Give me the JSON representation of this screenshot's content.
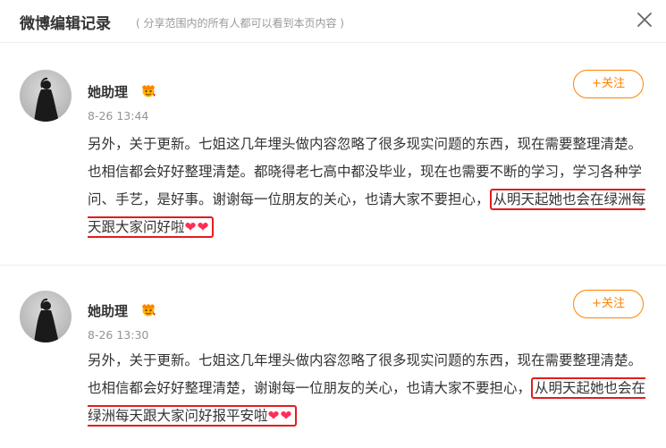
{
  "header": {
    "title": "微博编辑记录",
    "subtitle": "( 分享范围内的所有人都可以看到本页内容 )"
  },
  "posts": [
    {
      "author": "她助理",
      "time": "8-26 13:44",
      "follow_label": "+关注",
      "text_plain": "另外，关于更新。七姐这几年埋头做内容忽略了很多现实问题的东西，现在需要整理清楚。也相信都会好好整理清楚。都晓得老七高中都没毕业，现在也需要不断的学习，学习各种学问、手艺，是好事。谢谢每一位朋友的关心，也请大家不要担心，",
      "text_highlight": "从明天起她也会在绿洲每天跟大家问好啦",
      "hearts": "❤❤"
    },
    {
      "author": "她助理",
      "time": "8-26 13:30",
      "follow_label": "+关注",
      "text_plain": "另外，关于更新。七姐这几年埋头做内容忽略了很多现实问题的东西，现在需要整理清楚。也相信都会好好整理清楚，谢谢每一位朋友的关心，也请大家不要担心，",
      "text_highlight": "从明天起她也会在绿洲每天跟大家问好报平安啦",
      "hearts": "❤❤"
    }
  ],
  "colors": {
    "accent": "#ff8200",
    "highlight_border": "#e41c1c",
    "heart": "#ff2d55",
    "muted": "#999999"
  },
  "icons": [
    "close-icon",
    "avatar",
    "vip-badge-icon",
    "heart-icon"
  ]
}
